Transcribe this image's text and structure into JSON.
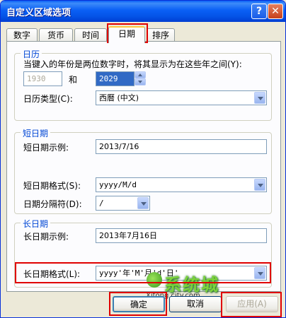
{
  "window": {
    "title": "自定义区域选项",
    "help": "?",
    "close": "✕"
  },
  "tabs": [
    "数字",
    "货币",
    "时间",
    "日期",
    "排序"
  ],
  "calendar": {
    "group_title": "日历",
    "desc": "当键入的年份是两位数字时，将其显示为在这些年之间(Y):",
    "year_from": "1930",
    "and_label": "和",
    "year_to": "2029",
    "type_label": "日历类型(C):",
    "type_value": "西曆 (中文)"
  },
  "short_date": {
    "group_title": "短日期",
    "sample_label": "短日期示例:",
    "sample_value": "2013/7/16",
    "format_label": "短日期格式(S):",
    "format_value": "yyyy/M/d",
    "separator_label": "日期分隔符(D):",
    "separator_value": "/"
  },
  "long_date": {
    "group_title": "长日期",
    "sample_label": "长日期示例:",
    "sample_value": "2013年7月16日",
    "format_label": "长日期格式(L):",
    "format_value": "yyyy'年'M'月'd'日'"
  },
  "buttons": {
    "ok": "确定",
    "cancel": "取消",
    "apply": "应用(A)"
  },
  "watermark": {
    "text": "系统城",
    "url": "Xitong city.com"
  },
  "colors": {
    "highlight": "#E00000",
    "titlebar": "#0A5FF5",
    "group_title": "#0046D5"
  }
}
